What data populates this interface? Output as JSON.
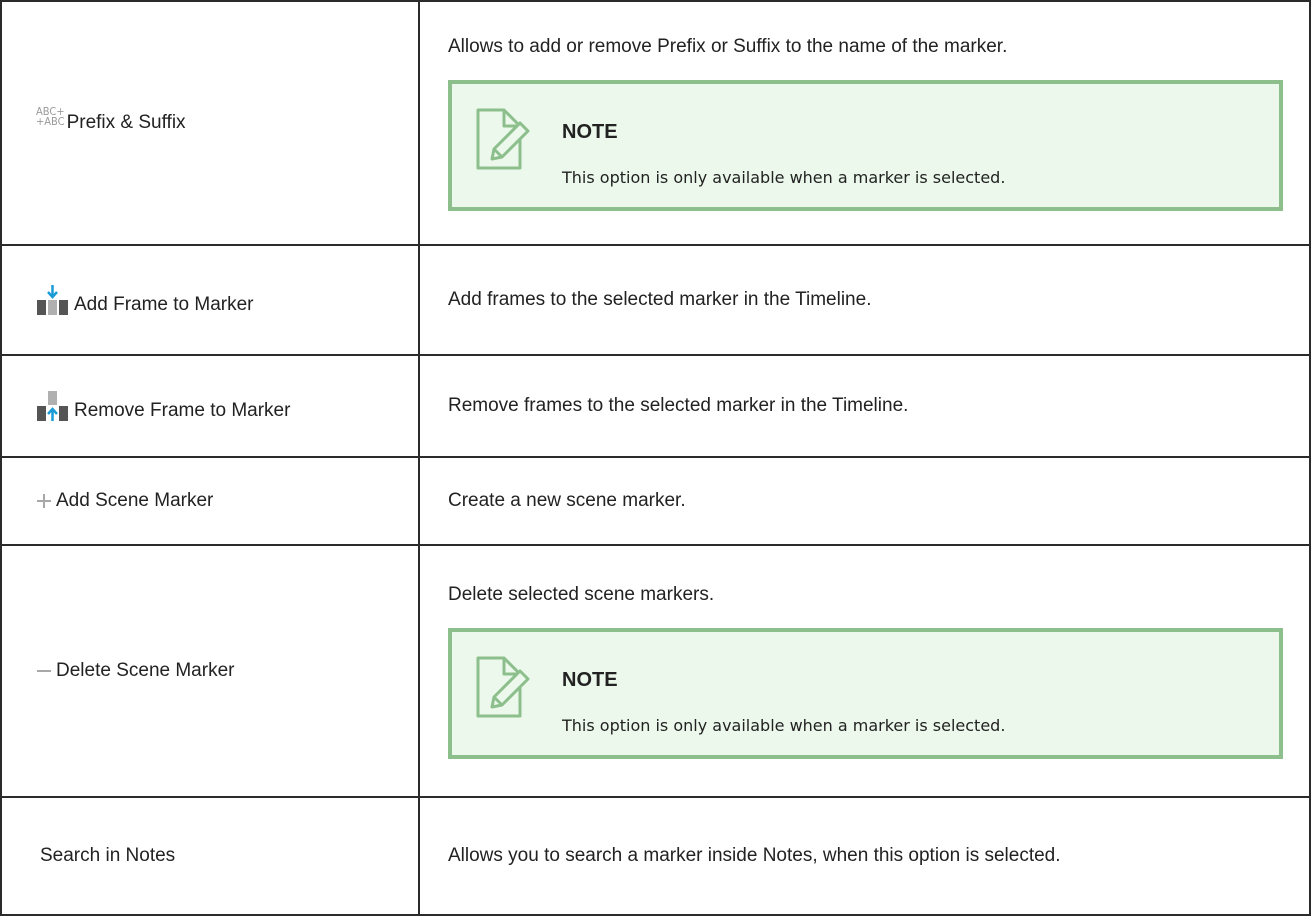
{
  "rows": [
    {
      "name": "Prefix & Suffix",
      "icon": "prefix-suffix-icon",
      "icon_text_top": "ABC+",
      "icon_text_bottom": "+ABC",
      "description": "Allows to add or remove Prefix or Suffix to the name of the marker.",
      "note": {
        "title": "NOTE",
        "body": "This option is only available when a marker is selected."
      }
    },
    {
      "name": "Add Frame to Marker",
      "icon": "add-frame-icon",
      "description": "Add frames to the selected marker in the Timeline."
    },
    {
      "name": "Remove Frame to Marker",
      "icon": "remove-frame-icon",
      "description": "Remove frames to the selected marker in the Timeline."
    },
    {
      "name": "Add Scene Marker",
      "icon": "plus-icon",
      "description": "Create a new scene marker."
    },
    {
      "name": "Delete Scene Marker",
      "icon": "minus-icon",
      "description": "Delete selected scene markers.",
      "note": {
        "title": "NOTE",
        "body": "This option is only available when a marker is selected."
      }
    },
    {
      "name": "Search in Notes",
      "description": "Allows you to search a marker inside Notes, when this option is selected."
    }
  ],
  "colors": {
    "border": "#2b2b2b",
    "note_border": "#8cbf8c",
    "note_background": "#ebf8eb",
    "icon_blue": "#1a9ad6",
    "icon_gray": "#b0b0b0"
  }
}
